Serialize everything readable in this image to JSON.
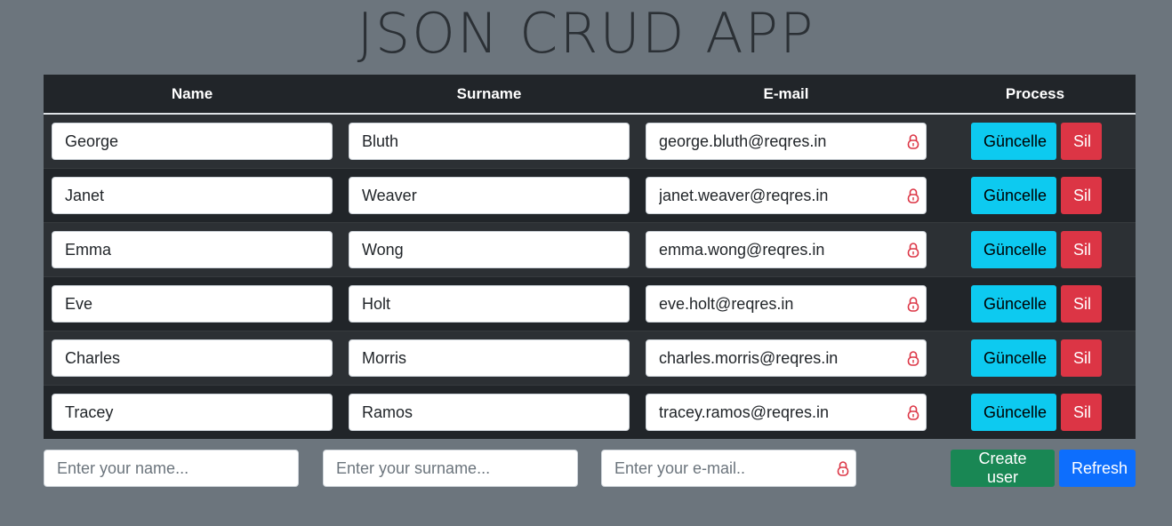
{
  "app": {
    "title": "JSON CRUD APP"
  },
  "table": {
    "headers": {
      "name": "Name",
      "surname": "Surname",
      "email": "E-mail",
      "process": "Process"
    },
    "rows": [
      {
        "name": "George",
        "surname": "Bluth",
        "email": "george.bluth@reqres.in"
      },
      {
        "name": "Janet",
        "surname": "Weaver",
        "email": "janet.weaver@reqres.in"
      },
      {
        "name": "Emma",
        "surname": "Wong",
        "email": "emma.wong@reqres.in"
      },
      {
        "name": "Eve",
        "surname": "Holt",
        "email": "eve.holt@reqres.in"
      },
      {
        "name": "Charles",
        "surname": "Morris",
        "email": "charles.morris@reqres.in"
      },
      {
        "name": "Tracey",
        "surname": "Ramos",
        "email": "tracey.ramos@reqres.in"
      }
    ],
    "update_label": "Güncelle",
    "delete_label": "Sil"
  },
  "form": {
    "name_placeholder": "Enter your name...",
    "surname_placeholder": "Enter your surname...",
    "email_placeholder": "Enter your e-mail..",
    "create_label": "Create user",
    "refresh_label": "Refresh"
  },
  "colors": {
    "background": "#6c757d",
    "table_dark": "#212529",
    "update_button": "#0dcaf0",
    "delete_button": "#dc3545",
    "create_button": "#198754",
    "refresh_button": "#0d6efd",
    "lock_icon": "#dc3545"
  },
  "icons": {
    "email_field": "lock-icon"
  }
}
